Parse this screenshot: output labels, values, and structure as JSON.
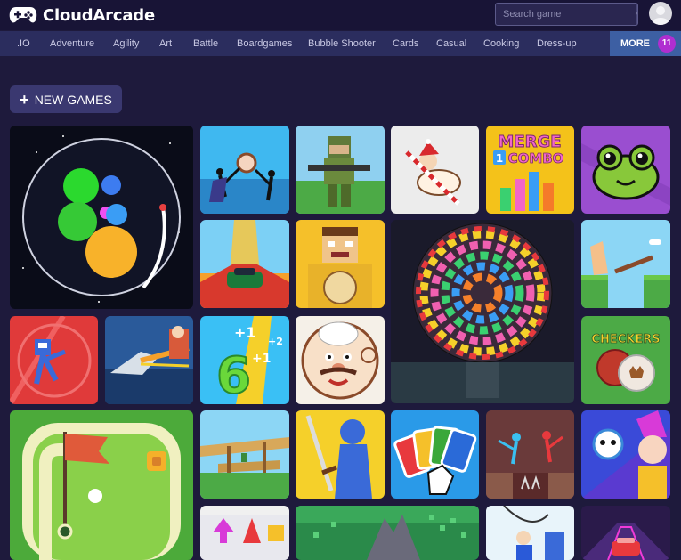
{
  "header": {
    "logo_text": "CloudArcade",
    "search_placeholder": "Search game"
  },
  "categories": [
    ".IO",
    "Adventure",
    "Agility",
    "Art",
    "Battle",
    "Boardgames",
    "Bubble Shooter",
    "Cards",
    "Casual",
    "Cooking",
    "Dress-up"
  ],
  "more": {
    "label": "MORE",
    "count": "11"
  },
  "new_games_label": "NEW GAMES",
  "tile_text": {
    "merge_1": "MERGE",
    "merge_2": "COMBO",
    "merge_num": "1",
    "checkers": "CHECKERS",
    "six": "6",
    "plus1a": "+1",
    "plus1b": "+1",
    "plus2": "+2"
  },
  "colors": {
    "background": "#1e1a3c",
    "topbar": "#181436",
    "catbar": "#2b2d5e",
    "more": "#3d5fa3",
    "badge": "#b02ed0"
  }
}
